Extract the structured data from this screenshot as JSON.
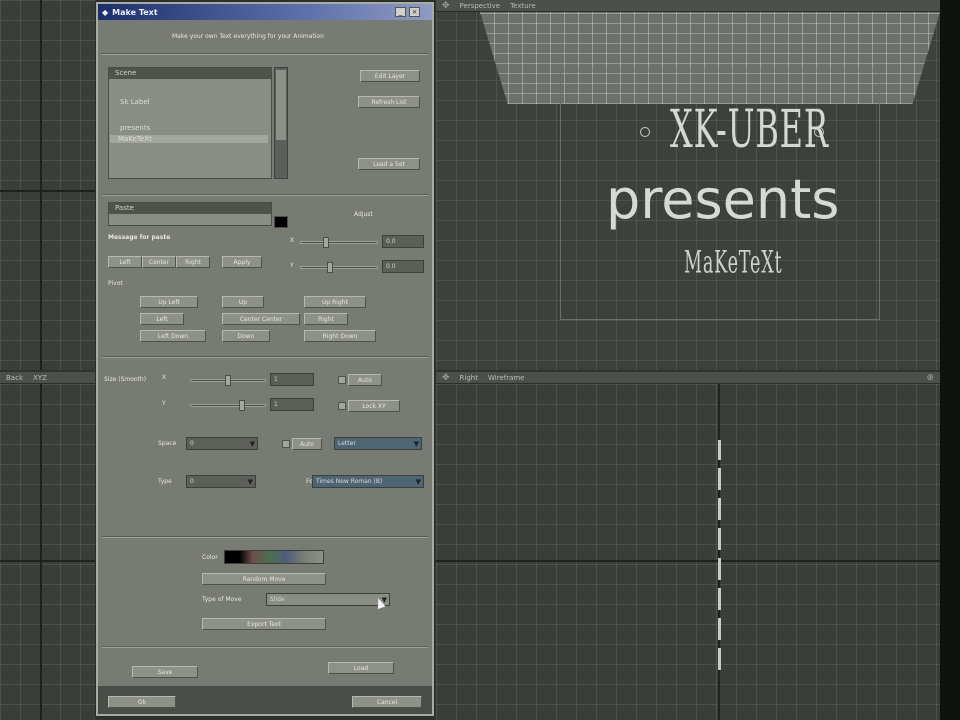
{
  "viewports": {
    "top_left": {
      "label": ""
    },
    "top_right": {
      "view": "Perspective",
      "mode": "Texture"
    },
    "bottom_left": {
      "view": "Back",
      "mode": "XYZ"
    },
    "bottom_right": {
      "view": "Right",
      "mode": "Wireframe"
    }
  },
  "title_graphic": {
    "top_text": "XK-UBER",
    "main_text": "presents",
    "bottom_text": "MaKeTeXt"
  },
  "dialog": {
    "title": "Make Text",
    "subtitle": "Make your own Text everything for your Animation",
    "buttons": {
      "edit_layer": "Edit Layer",
      "refresh": "Refresh List",
      "load": "Load a Set",
      "left": "Left",
      "center": "Center",
      "right": "Right",
      "apply": "Apply",
      "pivot_ul": "Up Left",
      "pivot_up": "Up",
      "pivot_ur": "Up Right",
      "pivot_left": "Left",
      "pivot_center": "Center Center",
      "pivot_right": "Right",
      "pivot_dl": "Left Down",
      "pivot_down": "Down",
      "pivot_dr": "Right Down",
      "random_move": "Random Move",
      "export": "Export Text",
      "bottom_left": "Save",
      "bottom_right": "Load",
      "ok": "Ok",
      "cancel": "Cancel"
    },
    "layer_list": {
      "header": "Scene",
      "items": [
        "Sk Label",
        "presents",
        "MaKeTeXt"
      ],
      "selected_index": 2
    },
    "paste_header": "Paste",
    "labels": {
      "message": "Message for paste",
      "adjust": "Adjust",
      "x": "X",
      "y": "Y",
      "pivot": "Pivot",
      "size": "Size (Smooth)",
      "auto": "Auto",
      "lock": "Lock XY",
      "space": "Space",
      "type": "Type",
      "font": "Font",
      "color": "Color",
      "type_of_move": "Type of Move"
    },
    "values": {
      "adjust_x": "0.0",
      "adjust_y": "0.0",
      "size_x": "1",
      "size_y": "1",
      "space": "0",
      "type": "0",
      "space_auto": "Auto",
      "letter": "Letter",
      "font": "Times New Roman (B)",
      "move": "Slide"
    }
  }
}
